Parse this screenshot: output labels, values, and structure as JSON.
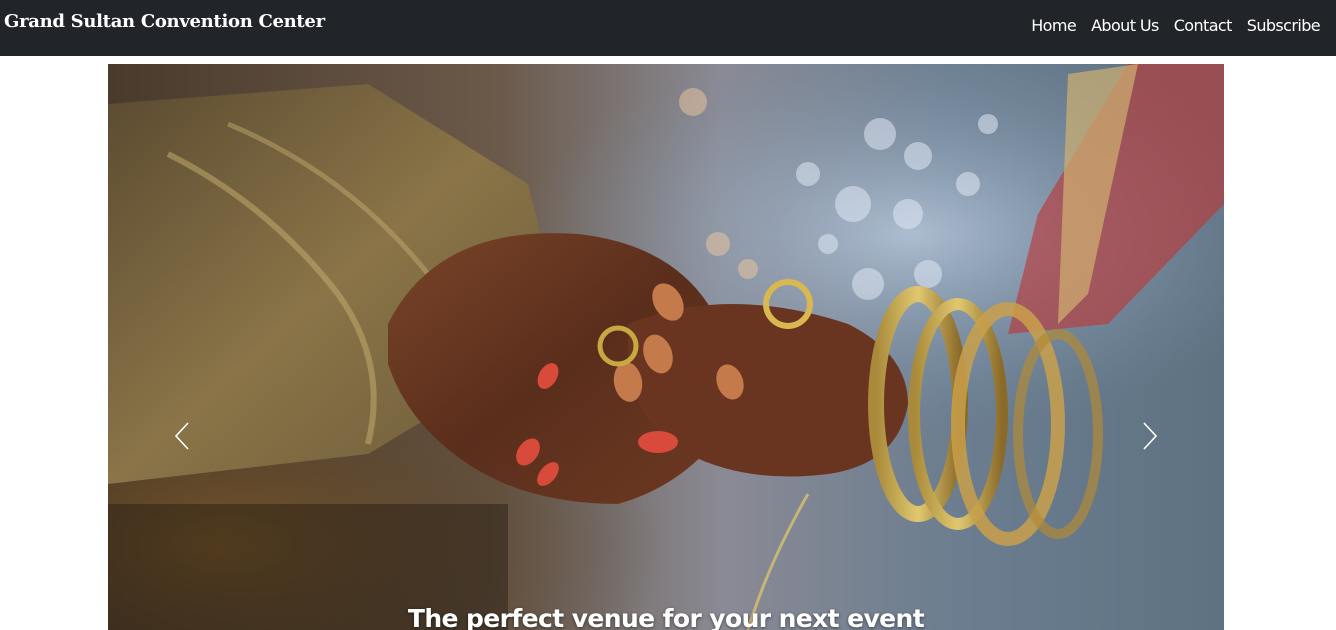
{
  "navbar": {
    "brand": "Grand Sultan Convention Center",
    "links": [
      "Home",
      "About Us",
      "Contact",
      "Subscribe"
    ],
    "background": "#212529"
  },
  "carousel": {
    "caption": "The perfect venue for your next event",
    "image_description_icon": "wedding-hands-henna-photo",
    "prev_icon": "chevron-left-icon",
    "next_icon": "chevron-right-icon"
  }
}
